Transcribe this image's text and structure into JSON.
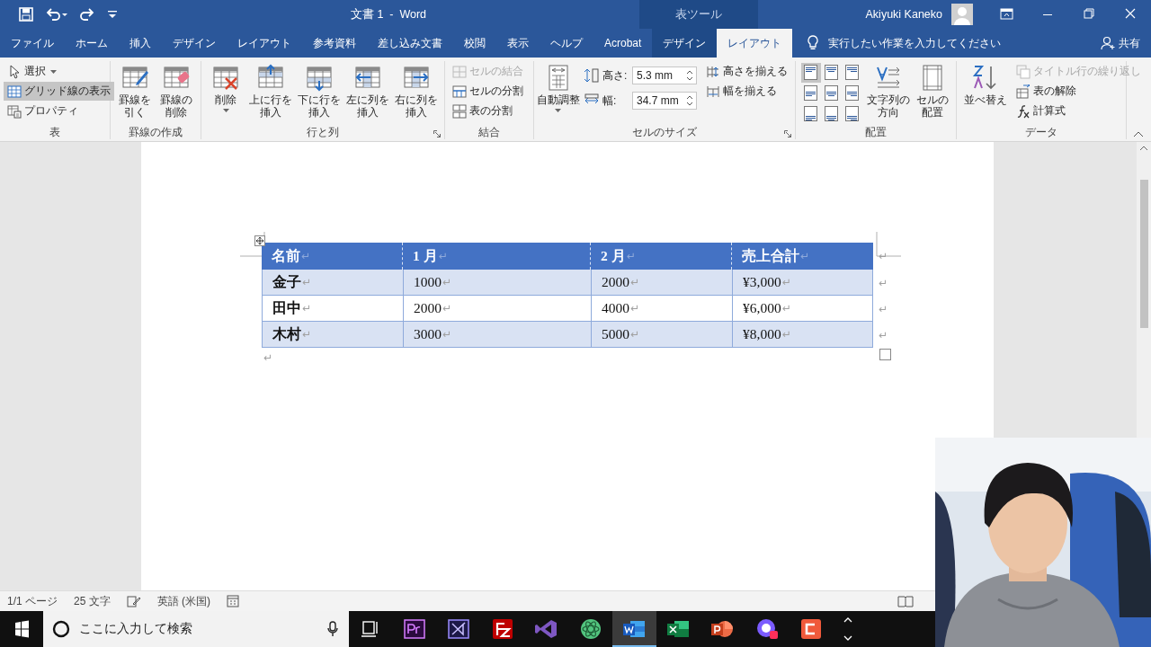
{
  "window": {
    "title": "文書 1  -  Word",
    "context_title": "表ツール",
    "user": "Akiyuki Kaneko"
  },
  "tabs": [
    {
      "label": "ファイル",
      "selected": false,
      "contextual": false
    },
    {
      "label": "ホーム",
      "selected": false,
      "contextual": false
    },
    {
      "label": "挿入",
      "selected": false,
      "contextual": false
    },
    {
      "label": "デザイン",
      "selected": false,
      "contextual": false
    },
    {
      "label": "レイアウト",
      "selected": false,
      "contextual": false
    },
    {
      "label": "参考資料",
      "selected": false,
      "contextual": false
    },
    {
      "label": "差し込み文書",
      "selected": false,
      "contextual": false
    },
    {
      "label": "校閲",
      "selected": false,
      "contextual": false
    },
    {
      "label": "表示",
      "selected": false,
      "contextual": false
    },
    {
      "label": "ヘルプ",
      "selected": false,
      "contextual": false
    },
    {
      "label": "Acrobat",
      "selected": false,
      "contextual": false
    },
    {
      "label": "デザイン",
      "selected": false,
      "contextual": true
    },
    {
      "label": "レイアウト",
      "selected": true,
      "contextual": true
    }
  ],
  "tell_me": {
    "placeholder": "実行したい作業を入力してください"
  },
  "share": "共有",
  "ribbon": {
    "groups": [
      {
        "label": "表",
        "launcher": false,
        "items": [
          {
            "kind": "stack",
            "items": [
              {
                "label": "選択",
                "caret": true,
                "disabled": false,
                "selected": false
              },
              {
                "label": "グリッド線の表示",
                "caret": false,
                "disabled": false,
                "selected": true
              },
              {
                "label": "プロパティ",
                "caret": false,
                "disabled": false,
                "selected": false
              }
            ]
          }
        ]
      },
      {
        "label": "罫線の作成",
        "launcher": false,
        "items": [
          {
            "kind": "large",
            "lines": [
              "罫線を",
              "引く"
            ],
            "caret": false
          },
          {
            "kind": "large",
            "lines": [
              "罫線の",
              "削除"
            ],
            "caret": false
          }
        ]
      },
      {
        "label": "行と列",
        "launcher": true,
        "items": [
          {
            "kind": "large",
            "lines": [
              "削除"
            ],
            "caret": true
          },
          {
            "kind": "large",
            "lines": [
              "上に行を",
              "挿入"
            ],
            "caret": false
          },
          {
            "kind": "large",
            "lines": [
              "下に行を",
              "挿入"
            ],
            "caret": false
          },
          {
            "kind": "large",
            "lines": [
              "左に列を",
              "挿入"
            ],
            "caret": false
          },
          {
            "kind": "large",
            "lines": [
              "右に列を",
              "挿入"
            ],
            "caret": false
          }
        ]
      },
      {
        "label": "結合",
        "launcher": false,
        "items": [
          {
            "kind": "stack",
            "items": [
              {
                "label": "セルの結合",
                "caret": false,
                "disabled": true,
                "selected": false
              },
              {
                "label": "セルの分割",
                "caret": false,
                "disabled": false,
                "selected": false
              },
              {
                "label": "表の分割",
                "caret": false,
                "disabled": false,
                "selected": false
              }
            ]
          }
        ]
      },
      {
        "label": "セルのサイズ",
        "launcher": true,
        "items": [
          {
            "kind": "large",
            "lines": [
              "自動調整"
            ],
            "caret": true
          },
          {
            "kind": "fields",
            "items": [
              {
                "label": "高さ:",
                "value": "5.3 mm"
              },
              {
                "label": "幅:",
                "value": "34.7 mm"
              }
            ]
          },
          {
            "kind": "stack",
            "items": [
              {
                "label": "高さを揃える",
                "caret": false,
                "disabled": false,
                "selected": false
              },
              {
                "label": "幅を揃える",
                "caret": false,
                "disabled": false,
                "selected": false
              }
            ]
          }
        ]
      },
      {
        "label": "配置",
        "launcher": false,
        "items": [
          {
            "kind": "align_grid",
            "cells": [
              {
                "selected": true
              },
              {
                "selected": false
              },
              {
                "selected": false
              },
              {
                "selected": false
              },
              {
                "selected": false
              },
              {
                "selected": false
              },
              {
                "selected": false
              },
              {
                "selected": false
              },
              {
                "selected": false
              }
            ]
          },
          {
            "kind": "large",
            "lines": [
              "文字列の",
              "方向"
            ],
            "caret": false
          },
          {
            "kind": "large",
            "lines": [
              "セルの",
              "配置"
            ],
            "caret": false
          }
        ]
      },
      {
        "label": "データ",
        "launcher": false,
        "items": [
          {
            "kind": "large",
            "lines": [
              "並べ替え"
            ],
            "caret": false
          },
          {
            "kind": "stack",
            "items": [
              {
                "label": "タイトル行の繰り返し",
                "caret": false,
                "disabled": true,
                "selected": false
              },
              {
                "label": "表の解除",
                "caret": false,
                "disabled": false,
                "selected": false
              },
              {
                "label": "計算式",
                "caret": false,
                "disabled": false,
                "selected": false
              }
            ]
          }
        ]
      }
    ]
  },
  "table": {
    "columns": [
      {
        "text": "名前",
        "mark": "↵"
      },
      {
        "text": "1 月",
        "mark": "↵"
      },
      {
        "text": "2 月",
        "mark": "↵"
      },
      {
        "text": "売上合計",
        "mark": "↵"
      }
    ],
    "rows": [
      {
        "cells": [
          {
            "text": "金子",
            "mark": "↵"
          },
          {
            "text": "1000",
            "mark": "↵"
          },
          {
            "text": "2000",
            "mark": "↵"
          },
          {
            "text": "¥3,000",
            "mark": "↵"
          }
        ],
        "end_mark": "↵"
      },
      {
        "cells": [
          {
            "text": "田中",
            "mark": "↵"
          },
          {
            "text": "2000",
            "mark": "↵"
          },
          {
            "text": "4000",
            "mark": "↵"
          },
          {
            "text": "¥6,000",
            "mark": "↵"
          }
        ],
        "end_mark": "↵"
      },
      {
        "cells": [
          {
            "text": "木村",
            "mark": "↵"
          },
          {
            "text": "3000",
            "mark": "↵"
          },
          {
            "text": "5000",
            "mark": "↵"
          },
          {
            "text": "¥8,000",
            "mark": "↵"
          }
        ],
        "end_mark": "↵"
      }
    ],
    "header_end_mark": "↵"
  },
  "paragraph_mark": "↵",
  "status_bar": {
    "page": "1/1 ページ",
    "words": "25 文字",
    "language": "英語 (米国)"
  },
  "taskbar": {
    "search": {
      "placeholder": "ここに入力して検索"
    },
    "apps": [
      {
        "selected": false
      },
      {
        "selected": false
      },
      {
        "selected": false
      },
      {
        "selected": false
      },
      {
        "selected": false
      },
      {
        "selected": true
      },
      {
        "selected": false
      },
      {
        "selected": false
      },
      {
        "selected": false
      },
      {
        "selected": false
      }
    ]
  }
}
